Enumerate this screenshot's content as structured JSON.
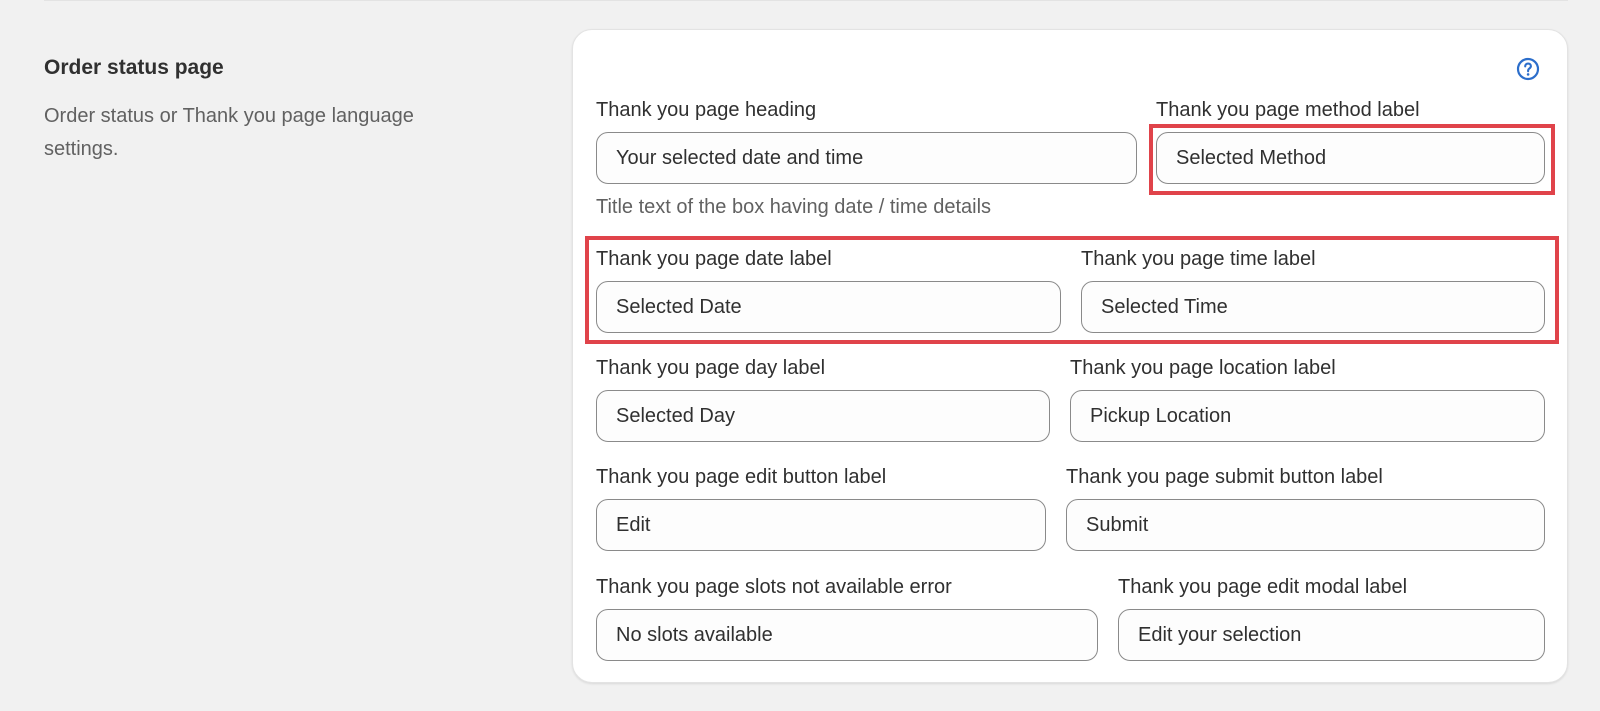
{
  "section": {
    "title": "Order status page",
    "description": "Order status or Thank you page language settings."
  },
  "help_icon": "question-circle-icon",
  "colors": {
    "highlight": "#e0434a",
    "help_icon": "#2c6ecb"
  },
  "fields": {
    "heading": {
      "label": "Thank you page heading",
      "value": "Your selected date and time",
      "help": "Title text of the box having date / time details"
    },
    "method": {
      "label": "Thank you page method label",
      "value": "Selected Method"
    },
    "date": {
      "label": "Thank you page date label",
      "value": "Selected Date"
    },
    "time": {
      "label": "Thank you page time label",
      "value": "Selected Time"
    },
    "day": {
      "label": "Thank you page day label",
      "value": "Selected Day"
    },
    "location": {
      "label": "Thank you page location label",
      "value": "Pickup Location"
    },
    "edit_button": {
      "label": "Thank you page edit button label",
      "value": "Edit"
    },
    "submit_button": {
      "label": "Thank you page submit button label",
      "value": "Submit"
    },
    "slots_error": {
      "label": "Thank you page slots not available error",
      "value": "No slots available"
    },
    "edit_modal": {
      "label": "Thank you page edit modal label",
      "value": "Edit your selection"
    }
  }
}
